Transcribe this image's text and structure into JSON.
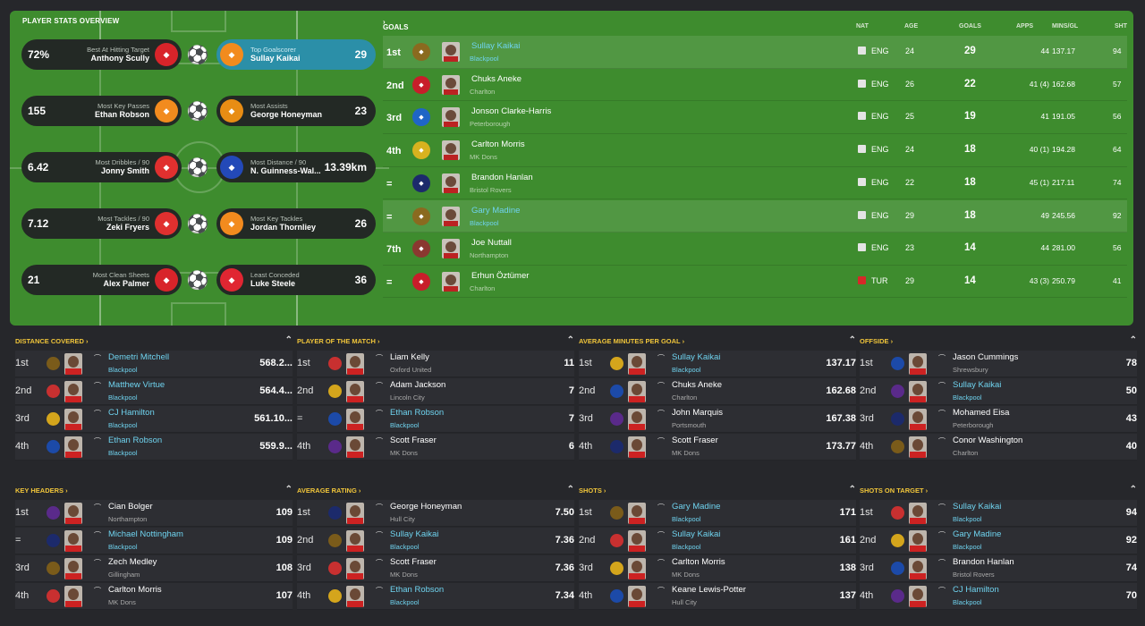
{
  "overview": {
    "title": "PLAYER STATS OVERVIEW",
    "pairs": [
      {
        "left": {
          "value": "72%",
          "label": "Best At Hitting Target",
          "name": "Anthony Scully"
        },
        "right": {
          "value": "29",
          "label": "Top Goalscorer",
          "name": "Sullay Kaikai"
        }
      },
      {
        "left": {
          "value": "155",
          "label": "Most Key Passes",
          "name": "Ethan Robson"
        },
        "right": {
          "value": "23",
          "label": "Most Assists",
          "name": "George Honeyman"
        }
      },
      {
        "left": {
          "value": "6.42",
          "label": "Most Dribbles / 90",
          "name": "Jonny Smith"
        },
        "right": {
          "value": "13.39km",
          "label": "Most Distance / 90",
          "name": "N. Guinness-Wal..."
        }
      },
      {
        "left": {
          "value": "7.12",
          "label": "Most Tackles / 90",
          "name": "Zeki Fryers"
        },
        "right": {
          "value": "26",
          "label": "Most Key Tackles",
          "name": "Jordan Thornliey"
        }
      },
      {
        "left": {
          "value": "21",
          "label": "Most Clean Sheets",
          "name": "Alex Palmer"
        },
        "right": {
          "value": "36",
          "label": "Least Conceded",
          "name": "Luke Steele"
        }
      }
    ]
  },
  "goals": {
    "title": "GOALS",
    "headers": {
      "nat": "NAT",
      "age": "AGE",
      "goals": "GOALS",
      "apps": "APPS",
      "mins": "MINS/GL",
      "sht": "SHT"
    },
    "rows": [
      {
        "pos": "1st",
        "name": "Sullay Kaikai",
        "club": "Blackpool",
        "nat": "ENG",
        "age": "24",
        "goals": "29",
        "apps": "44",
        "mins": "137.17",
        "sht": "94",
        "highlight": true
      },
      {
        "pos": "2nd",
        "name": "Chuks Aneke",
        "club": "Charlton",
        "nat": "ENG",
        "age": "26",
        "goals": "22",
        "apps": "41 (4)",
        "mins": "162.68",
        "sht": "57",
        "highlight": false
      },
      {
        "pos": "3rd",
        "name": "Jonson Clarke-Harris",
        "club": "Peterborough",
        "nat": "ENG",
        "age": "25",
        "goals": "19",
        "apps": "41",
        "mins": "191.05",
        "sht": "56",
        "highlight": false
      },
      {
        "pos": "4th",
        "name": "Carlton Morris",
        "club": "MK Dons",
        "nat": "ENG",
        "age": "24",
        "goals": "18",
        "apps": "40 (1)",
        "mins": "194.28",
        "sht": "64",
        "highlight": false
      },
      {
        "pos": "=",
        "name": "Brandon Hanlan",
        "club": "Bristol Rovers",
        "nat": "ENG",
        "age": "22",
        "goals": "18",
        "apps": "45 (1)",
        "mins": "217.11",
        "sht": "74",
        "highlight": false
      },
      {
        "pos": "=",
        "name": "Gary Madine",
        "club": "Blackpool",
        "nat": "ENG",
        "age": "29",
        "goals": "18",
        "apps": "49",
        "mins": "245.56",
        "sht": "92",
        "highlight": true
      },
      {
        "pos": "7th",
        "name": "Joe Nuttall",
        "club": "Northampton",
        "nat": "ENG",
        "age": "23",
        "goals": "14",
        "apps": "44",
        "mins": "281.00",
        "sht": "56",
        "highlight": false
      },
      {
        "pos": "=",
        "name": "Erhun Öztümer",
        "club": "Charlton",
        "nat": "TUR",
        "age": "29",
        "goals": "14",
        "apps": "43 (3)",
        "mins": "250.79",
        "sht": "41",
        "highlight": false
      }
    ]
  },
  "panels": [
    {
      "title": "DISTANCE COVERED",
      "rows": [
        {
          "pos": "1st",
          "name": "Demetri Mitchell",
          "club": "Blackpool",
          "value": "568.2...",
          "link": true
        },
        {
          "pos": "2nd",
          "name": "Matthew Virtue",
          "club": "Blackpool",
          "value": "564.4...",
          "link": true
        },
        {
          "pos": "3rd",
          "name": "CJ Hamilton",
          "club": "Blackpool",
          "value": "561.10...",
          "link": true
        },
        {
          "pos": "4th",
          "name": "Ethan Robson",
          "club": "Blackpool",
          "value": "559.9...",
          "link": true
        }
      ]
    },
    {
      "title": "PLAYER OF THE MATCH",
      "rows": [
        {
          "pos": "1st",
          "name": "Liam Kelly",
          "club": "Oxford United",
          "value": "11",
          "link": false
        },
        {
          "pos": "2nd",
          "name": "Adam Jackson",
          "club": "Lincoln City",
          "value": "7",
          "link": false
        },
        {
          "pos": "=",
          "name": "Ethan Robson",
          "club": "Blackpool",
          "value": "7",
          "link": true
        },
        {
          "pos": "4th",
          "name": "Scott Fraser",
          "club": "MK Dons",
          "value": "6",
          "link": false
        }
      ]
    },
    {
      "title": "AVERAGE MINUTES PER GOAL",
      "rows": [
        {
          "pos": "1st",
          "name": "Sullay Kaikai",
          "club": "Blackpool",
          "value": "137.17",
          "link": true
        },
        {
          "pos": "2nd",
          "name": "Chuks Aneke",
          "club": "Charlton",
          "value": "162.68",
          "link": false
        },
        {
          "pos": "3rd",
          "name": "John Marquis",
          "club": "Portsmouth",
          "value": "167.38",
          "link": false
        },
        {
          "pos": "4th",
          "name": "Scott Fraser",
          "club": "MK Dons",
          "value": "173.77",
          "link": false
        }
      ]
    },
    {
      "title": "OFFSIDE",
      "rows": [
        {
          "pos": "1st",
          "name": "Jason Cummings",
          "club": "Shrewsbury",
          "value": "78",
          "link": false
        },
        {
          "pos": "2nd",
          "name": "Sullay Kaikai",
          "club": "Blackpool",
          "value": "50",
          "link": true
        },
        {
          "pos": "3rd",
          "name": "Mohamed Eisa",
          "club": "Peterborough",
          "value": "43",
          "link": false
        },
        {
          "pos": "4th",
          "name": "Conor Washington",
          "club": "Charlton",
          "value": "40",
          "link": false
        }
      ]
    },
    {
      "title": "KEY HEADERS",
      "rows": [
        {
          "pos": "1st",
          "name": "Cian Bolger",
          "club": "Northampton",
          "value": "109",
          "link": false
        },
        {
          "pos": "=",
          "name": "Michael Nottingham",
          "club": "Blackpool",
          "value": "109",
          "link": true
        },
        {
          "pos": "3rd",
          "name": "Zech Medley",
          "club": "Gillingham",
          "value": "108",
          "link": false
        },
        {
          "pos": "4th",
          "name": "Carlton Morris",
          "club": "MK Dons",
          "value": "107",
          "link": false
        }
      ]
    },
    {
      "title": "AVERAGE RATING",
      "rows": [
        {
          "pos": "1st",
          "name": "George Honeyman",
          "club": "Hull City",
          "value": "7.50",
          "link": false
        },
        {
          "pos": "2nd",
          "name": "Sullay Kaikai",
          "club": "Blackpool",
          "value": "7.36",
          "link": true
        },
        {
          "pos": "3rd",
          "name": "Scott Fraser",
          "club": "MK Dons",
          "value": "7.36",
          "link": false
        },
        {
          "pos": "4th",
          "name": "Ethan Robson",
          "club": "Blackpool",
          "value": "7.34",
          "link": true
        }
      ]
    },
    {
      "title": "SHOTS",
      "rows": [
        {
          "pos": "1st",
          "name": "Gary Madine",
          "club": "Blackpool",
          "value": "171",
          "link": true
        },
        {
          "pos": "2nd",
          "name": "Sullay Kaikai",
          "club": "Blackpool",
          "value": "161",
          "link": true
        },
        {
          "pos": "3rd",
          "name": "Carlton Morris",
          "club": "MK Dons",
          "value": "138",
          "link": false
        },
        {
          "pos": "4th",
          "name": "Keane Lewis-Potter",
          "club": "Hull City",
          "value": "137",
          "link": false
        }
      ]
    },
    {
      "title": "SHOTS ON TARGET",
      "rows": [
        {
          "pos": "1st",
          "name": "Sullay Kaikai",
          "club": "Blackpool",
          "value": "94",
          "link": true
        },
        {
          "pos": "2nd",
          "name": "Gary Madine",
          "club": "Blackpool",
          "value": "92",
          "link": true
        },
        {
          "pos": "3rd",
          "name": "Brandon Hanlan",
          "club": "Bristol Rovers",
          "value": "74",
          "link": false
        },
        {
          "pos": "4th",
          "name": "CJ Hamilton",
          "club": "Blackpool",
          "value": "70",
          "link": true
        }
      ]
    }
  ],
  "colors": {
    "accent": "#f0c53a",
    "link": "#6fd3ef",
    "pitch": "#3e8c2e",
    "highlight": "#2b8fa8"
  }
}
